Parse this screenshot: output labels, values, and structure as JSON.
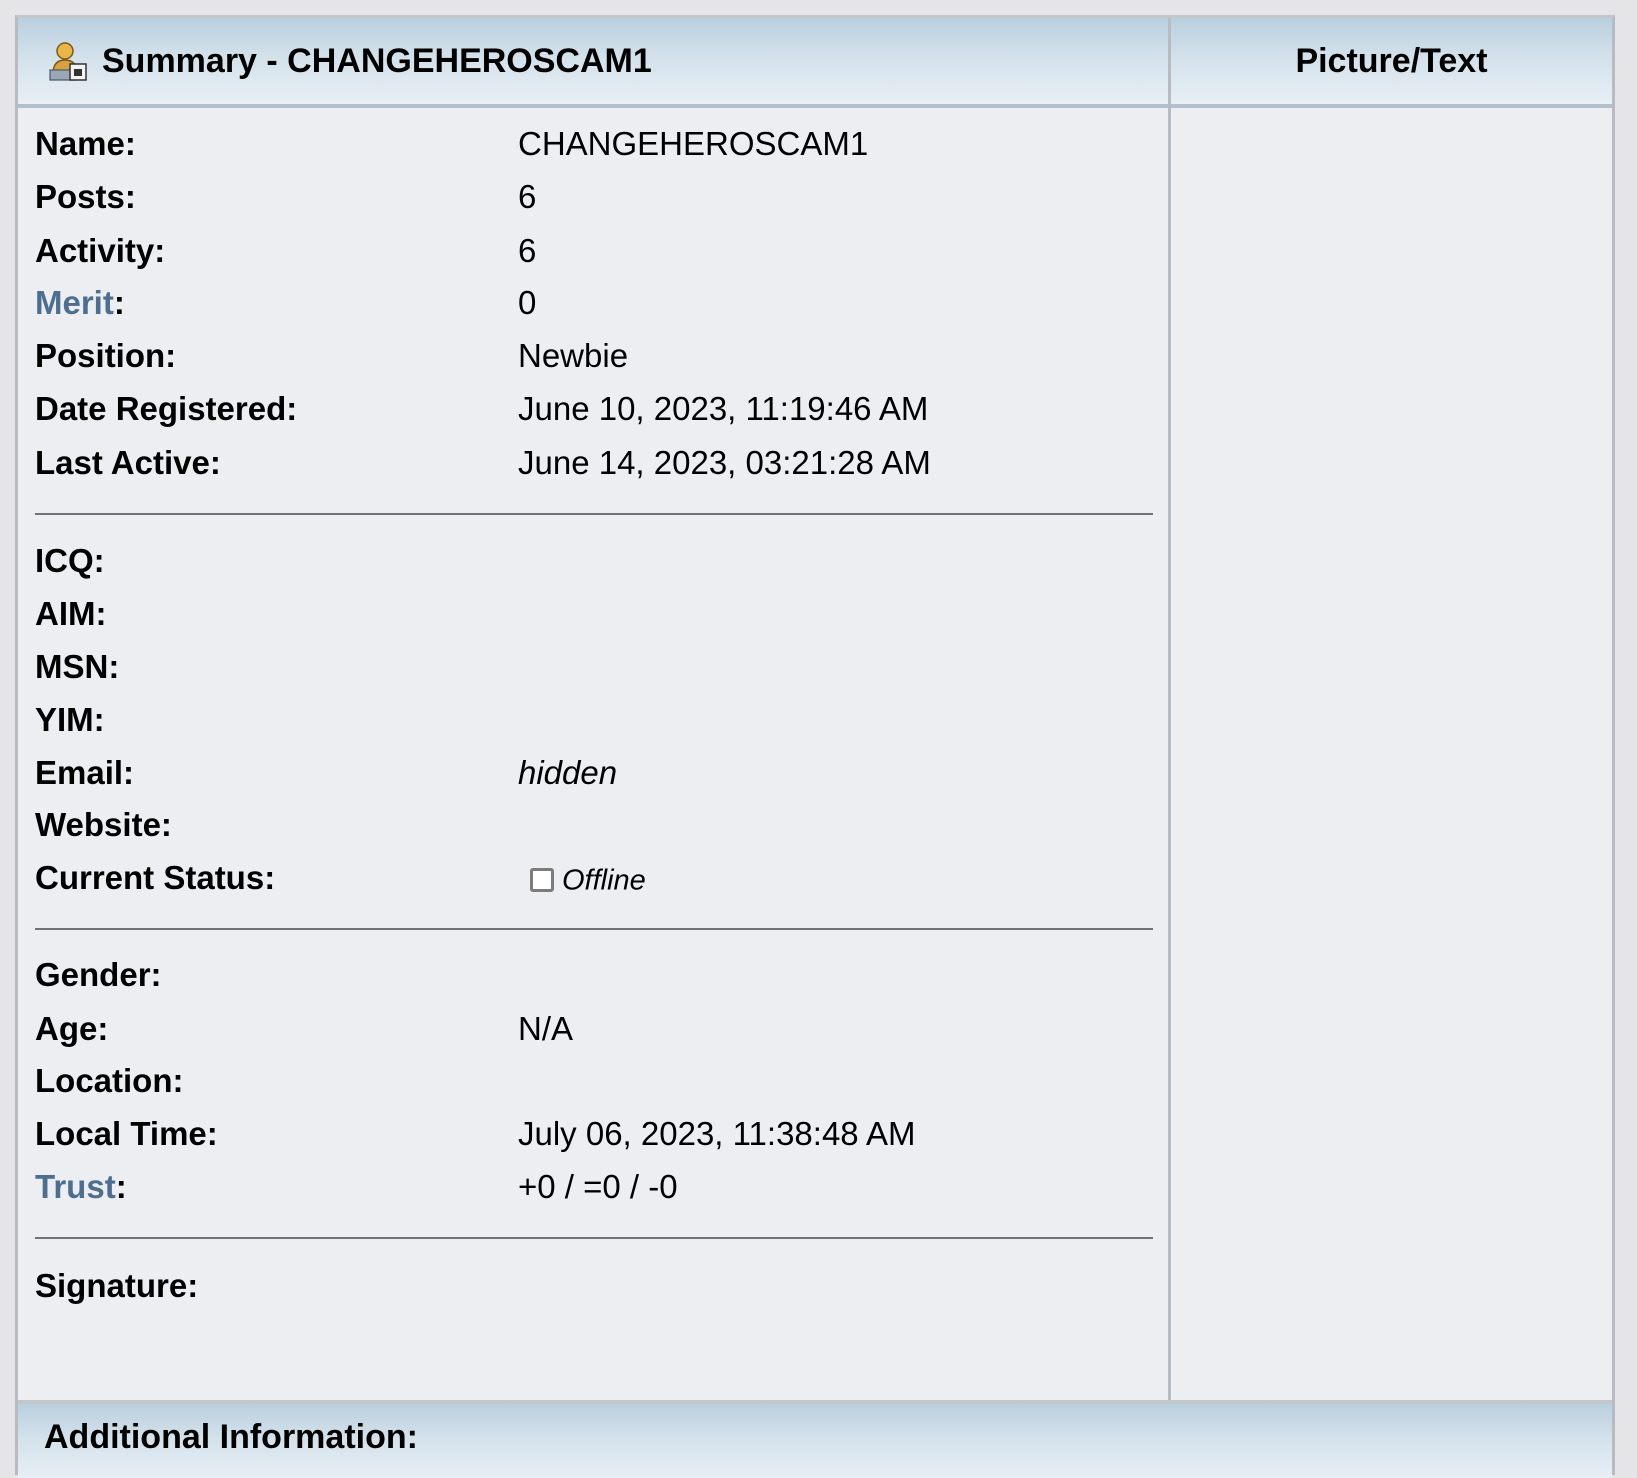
{
  "header": {
    "summary_title": "Summary - CHANGEHEROSCAM1",
    "picture_title": "Picture/Text"
  },
  "profile": {
    "name_label": "Name:",
    "name_value": "CHANGEHEROSCAM1",
    "posts_label": "Posts:",
    "posts_value": "6",
    "activity_label": "Activity:",
    "activity_value": "6",
    "merit_link": "Merit",
    "merit_colon": ":",
    "merit_value": "0",
    "position_label": "Position:",
    "position_value": "Newbie",
    "registered_label": "Date Registered:",
    "registered_value": "June 10, 2023, 11:19:46 AM",
    "last_active_label": "Last Active:",
    "last_active_value": "June 14, 2023, 03:21:28 AM"
  },
  "contact": {
    "icq_label": "ICQ:",
    "aim_label": "AIM:",
    "msn_label": "MSN:",
    "yim_label": "YIM:",
    "email_label": "Email:",
    "email_value": "hidden",
    "website_label": "Website:",
    "status_label": "Current Status:",
    "status_value": "Offline"
  },
  "personal": {
    "gender_label": "Gender:",
    "age_label": "Age:",
    "age_value": "N/A",
    "location_label": "Location:",
    "local_time_label": "Local Time:",
    "local_time_value": "July 06, 2023, 11:38:48 AM",
    "trust_link": "Trust",
    "trust_colon": ":",
    "trust_value": "+0 / =0 / -0"
  },
  "signature": {
    "label": "Signature:"
  },
  "additional": {
    "title": "Additional Information:"
  },
  "icons": {
    "header_icon": "user-icon",
    "status_icon": "offline-checkbox-icon"
  },
  "colors": {
    "link": "#4d6e8f",
    "header_gradient_top": "#b9cfde",
    "header_gradient_bottom": "#e8eff5",
    "panel_bg": "#eceef2"
  }
}
